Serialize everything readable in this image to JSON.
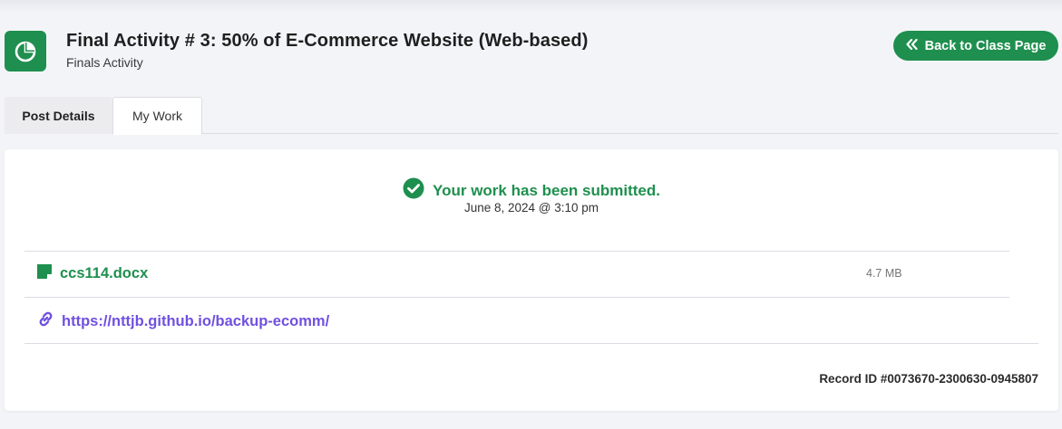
{
  "header": {
    "title": "Final Activity # 3: 50% of E-Commerce Website (Web-based)",
    "subtitle": "Finals Activity",
    "back_button_label": "Back to Class Page",
    "app_icon": "pie-chart-icon",
    "back_icon": "double-chevron-left-icon"
  },
  "tabs": [
    {
      "label": "Post Details",
      "active": false
    },
    {
      "label": "My Work",
      "active": true
    }
  ],
  "submission": {
    "status_text": "Your work has been submitted.",
    "status_icon": "check-circle-icon",
    "date": "June 8, 2024 @ 3:10 pm"
  },
  "attachments": {
    "file": {
      "name": "ccs114.docx",
      "size": "4.7 MB",
      "icon": "document-icon"
    },
    "link": {
      "url": "https://nttjb.github.io/backup-ecomm/",
      "icon": "link-icon"
    }
  },
  "record_id": "Record ID #0073670-2300630-0945807",
  "colors": {
    "accent": "#1e8f4e",
    "link": "#7050e0",
    "background": "#f3f4f8"
  }
}
